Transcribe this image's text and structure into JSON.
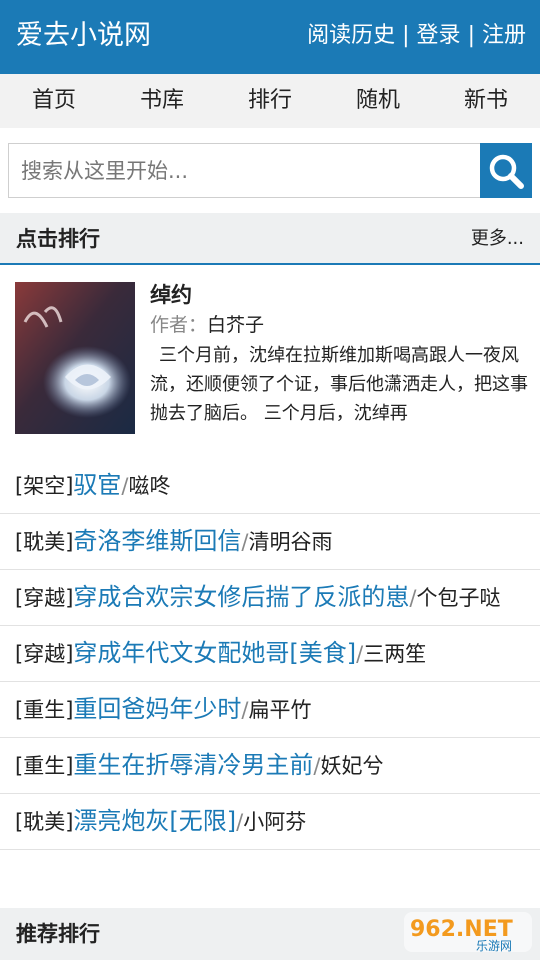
{
  "header": {
    "site_title": "爱去小说网",
    "links": [
      "阅读历史",
      "登录",
      "注册"
    ],
    "separator": "|"
  },
  "nav": {
    "items": [
      "首页",
      "书库",
      "排行",
      "随机",
      "新书"
    ]
  },
  "search": {
    "placeholder": "搜索从这里开始..."
  },
  "click_rank": {
    "title": "点击排行",
    "more": "更多...",
    "featured": {
      "title": "绰约",
      "author_label": "作者：",
      "author": "白芥子",
      "description": "三个月前，沈绰在拉斯维加斯喝高跟人一夜风流，还顺便领了个证，事后他潇洒走人，把这事抛去了脑后。 三个月后，沈绰再"
    },
    "items": [
      {
        "category": "[架空]",
        "name": "驭宦",
        "author": "嗞咚"
      },
      {
        "category": "[耽美]",
        "name": "奇洛李维斯回信",
        "author": "清明谷雨"
      },
      {
        "category": "[穿越]",
        "name": "穿成合欢宗女修后揣了反派的崽",
        "author": "个包子哒"
      },
      {
        "category": "[穿越]",
        "name": "穿成年代文女配她哥[美食]",
        "author": "三两笙"
      },
      {
        "category": "[重生]",
        "name": "重回爸妈年少时",
        "author": "扁平竹"
      },
      {
        "category": "[重生]",
        "name": "重生在折辱清冷男主前",
        "author": "妖妃兮"
      },
      {
        "category": "[耽美]",
        "name": "漂亮炮灰[无限]",
        "author": "小阿芬"
      }
    ]
  },
  "recommend_rank": {
    "title": "推荐排行"
  },
  "watermark": {
    "brand": "962.NET",
    "sub": "乐游网"
  },
  "colors": {
    "primary": "#1b7ab6",
    "nav_bg": "#f2f2f2",
    "section_bg": "#eef0f1"
  }
}
